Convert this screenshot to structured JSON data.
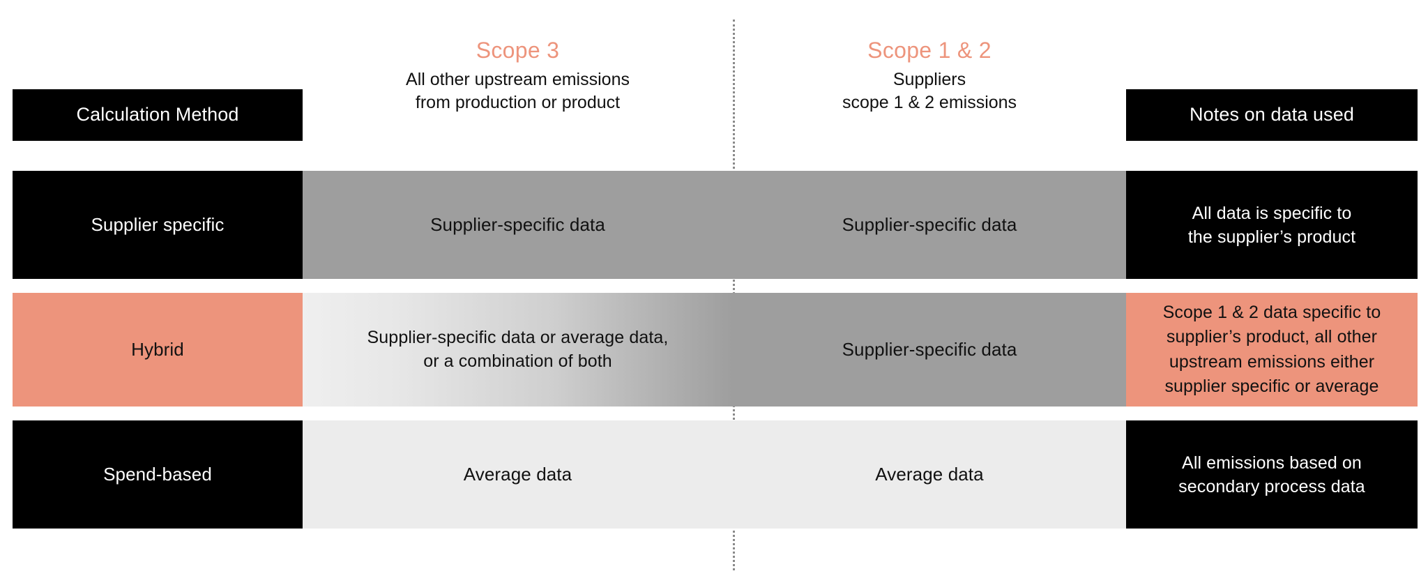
{
  "figure": {
    "type": "matrix-table",
    "accent_color": "#ED947C",
    "dark_color": "#000000",
    "gray_color": "#9E9E9E",
    "light_gray_color": "#ECECEC"
  },
  "header": {
    "method_label": "Calculation Method",
    "notes_label": "Notes on data used",
    "scope3": {
      "title": "Scope 3",
      "subtitle_line1": "All other upstream emissions",
      "subtitle_line2": "from production or product"
    },
    "scope12": {
      "title": "Scope 1 & 2",
      "subtitle_line1": "Suppliers",
      "subtitle_line2": "scope 1 & 2 emissions"
    }
  },
  "rows": [
    {
      "method": "Supplier specific",
      "method_style": "dark",
      "scope3": "Supplier-specific data",
      "scope3_style": "gray",
      "scope12": "Supplier-specific data",
      "scope12_style": "gray",
      "notes_line1": "All data is specific to",
      "notes_line2": "the supplier’s product",
      "notes_style": "dark"
    },
    {
      "method": "Hybrid",
      "method_style": "salmon",
      "scope3_line1": "Supplier-specific data or average data,",
      "scope3_line2": "or a combination of both",
      "scope3_style": "gradient",
      "scope12": "Supplier-specific data",
      "scope12_style": "gray",
      "notes_line1": "Scope 1 & 2 data specific to",
      "notes_line2": "supplier’s product, all other",
      "notes_line3": "upstream emissions either",
      "notes_line4": "supplier specific or average",
      "notes_style": "salmon"
    },
    {
      "method": "Spend-based",
      "method_style": "dark",
      "scope3": "Average data",
      "scope3_style": "light",
      "scope12": "Average data",
      "scope12_style": "light",
      "notes_line1": "All emissions based on",
      "notes_line2": "secondary process data",
      "notes_style": "dark"
    }
  ]
}
